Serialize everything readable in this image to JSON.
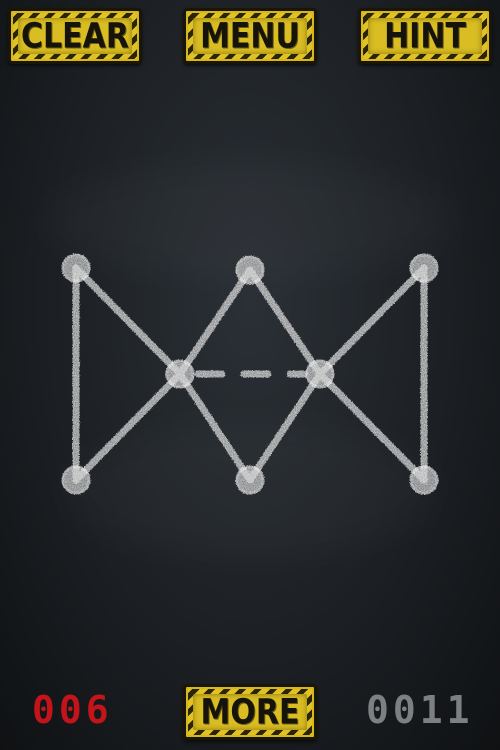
{
  "toolbar": {
    "clear_label": "CLEAR",
    "menu_label": "MENU",
    "hint_label": "HINT"
  },
  "footer": {
    "moves": "006",
    "more_label": "MORE",
    "level": "0011"
  },
  "colors": {
    "button_yellow": "#d9bd23",
    "button_stripe": "#2a2408",
    "moves_red": "#c4141a",
    "level_gray": "#7d7f82",
    "chalk": "#e6e6e6",
    "board": "#1f2327"
  },
  "puzzle": {
    "node_count": 8,
    "edge_count": 11,
    "dashed_edge_count": 1
  }
}
